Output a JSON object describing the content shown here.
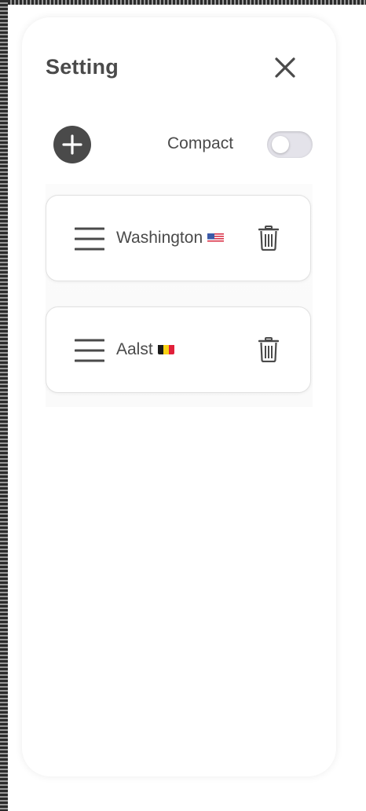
{
  "panel": {
    "title": "Setting",
    "close_icon": "close-icon",
    "add_icon": "plus-circle-icon"
  },
  "compact": {
    "label": "Compact",
    "enabled": false
  },
  "locations": [
    {
      "name": "Washington",
      "flag_icon": "us-flag-icon"
    },
    {
      "name": "Aalst",
      "flag_icon": "belgium-flag-icon"
    }
  ],
  "colors": {
    "text": "#4a4a4a",
    "toggle_off": "#e4e3ea",
    "card_border": "#e1e1e1",
    "flag_us_red": "#d8283f",
    "flag_us_blue": "#3c5aa8",
    "flag_be_black": "#1a1a1a",
    "flag_be_yellow": "#f7d215",
    "flag_be_red": "#e1203a"
  }
}
